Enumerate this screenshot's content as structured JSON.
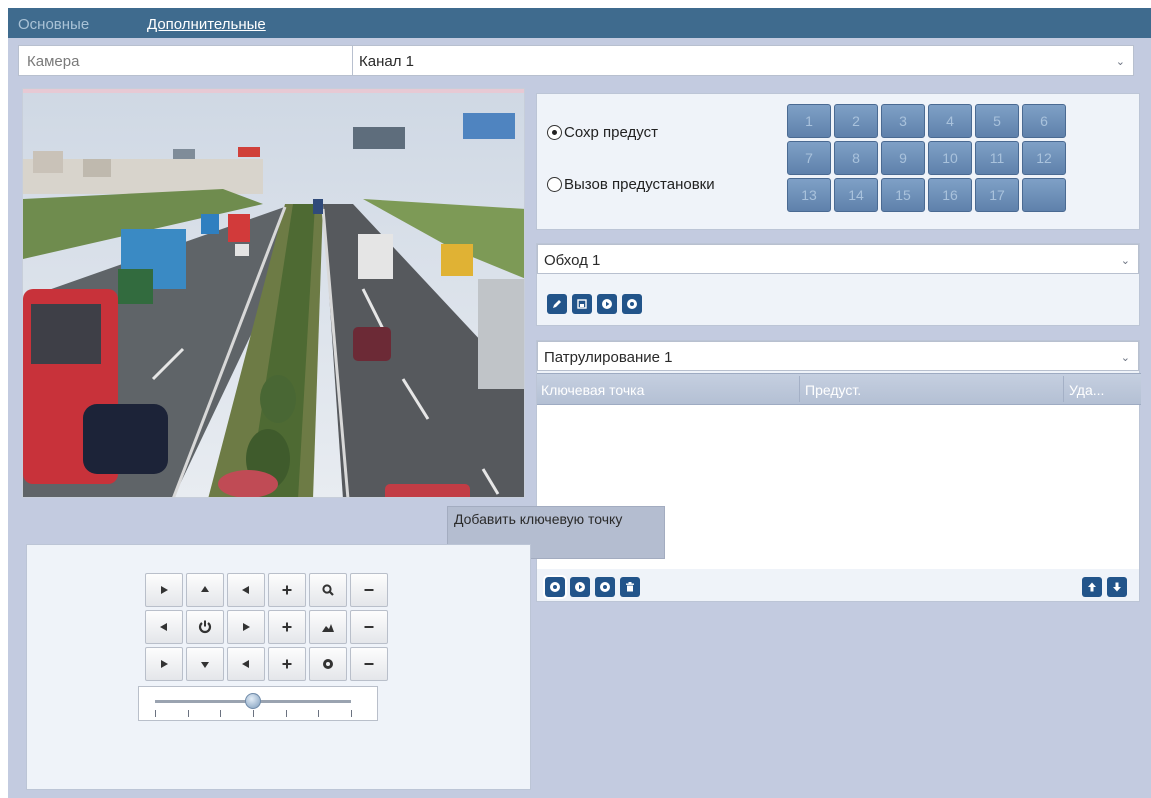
{
  "tabs": {
    "basic": "Основные",
    "advanced": "Дополнительные"
  },
  "camera": {
    "label": "Камера",
    "channel": "Канал 1"
  },
  "preset": {
    "save_label": "Сохр предуст",
    "call_label": "Вызов предустановки",
    "selected": "save",
    "buttons": [
      "1",
      "2",
      "3",
      "4",
      "5",
      "6",
      "7",
      "8",
      "9",
      "10",
      "11",
      "12",
      "13",
      "14",
      "15",
      "16",
      "17",
      ""
    ]
  },
  "tour": {
    "selected": "Обход 1",
    "icons": [
      "pencil-icon",
      "save-icon",
      "play-icon",
      "stop-icon"
    ]
  },
  "patrol": {
    "selected": "Патрулирование 1",
    "columns": {
      "key_point": "Ключевая точка",
      "preset": "Предуст.",
      "delete": "Уда..."
    },
    "rows": [],
    "icons": [
      "add-icon",
      "play-icon",
      "stop-icon",
      "trash-icon",
      "arrow-up-icon",
      "arrow-down-icon"
    ],
    "tooltip": "Добавить ключевую точку"
  },
  "ptz": {
    "speed_level": 0.5,
    "icons": [
      "arrow-up-left-icon",
      "arrow-up-icon",
      "arrow-up-right-icon",
      "plus-icon",
      "zoom-icon",
      "minus-icon",
      "arrow-left-icon",
      "auto-pan-icon",
      "arrow-right-icon",
      "plus-icon",
      "focus-icon",
      "minus-icon",
      "arrow-down-left-icon",
      "arrow-down-icon",
      "arrow-down-right-icon",
      "plus-icon",
      "iris-icon",
      "minus-icon"
    ]
  },
  "colors": {
    "tab_bar": "#3f6b8e",
    "preset_button": "#6d8fb8",
    "icon_button": "#22548a",
    "background": "#c3cbe0"
  }
}
